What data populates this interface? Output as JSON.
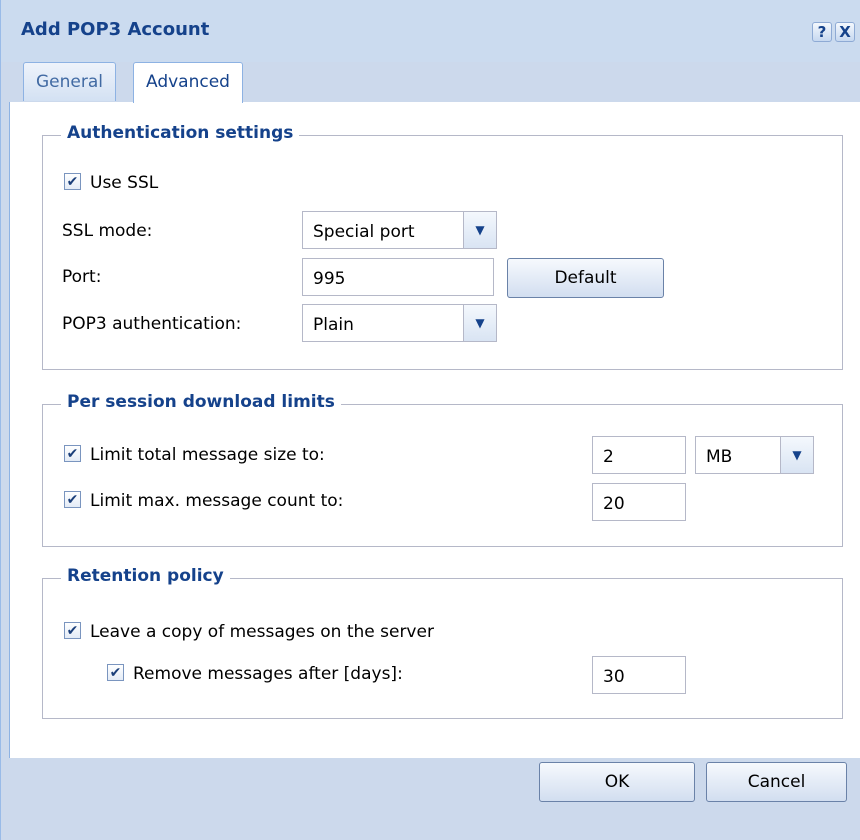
{
  "window": {
    "title": "Add POP3 Account",
    "help_icon": "?",
    "close_icon": "X"
  },
  "tabs": [
    {
      "label": "General",
      "active": false
    },
    {
      "label": "Advanced",
      "active": true
    }
  ],
  "authentication": {
    "legend": "Authentication settings",
    "use_ssl": {
      "label": "Use SSL",
      "checked": true
    },
    "ssl_mode": {
      "label": "SSL mode:",
      "value": "Special port"
    },
    "port": {
      "label": "Port:",
      "value": "995",
      "button": "Default"
    },
    "pop3_auth": {
      "label": "POP3 authentication:",
      "value": "Plain"
    }
  },
  "limits": {
    "legend": "Per session download limits",
    "size": {
      "label": "Limit total message size to:",
      "checked": true,
      "value": "2",
      "unit": "MB"
    },
    "count": {
      "label": "Limit max. message count to:",
      "checked": true,
      "value": "20"
    }
  },
  "retention": {
    "legend": "Retention policy",
    "leave_copy": {
      "label": "Leave a copy of messages on the server",
      "checked": true
    },
    "remove_after": {
      "label": "Remove messages after [days]:",
      "checked": true,
      "value": "30"
    }
  },
  "footer": {
    "ok": "OK",
    "cancel": "Cancel"
  },
  "glyphs": {
    "check": "✔",
    "dropdown": "▼"
  }
}
